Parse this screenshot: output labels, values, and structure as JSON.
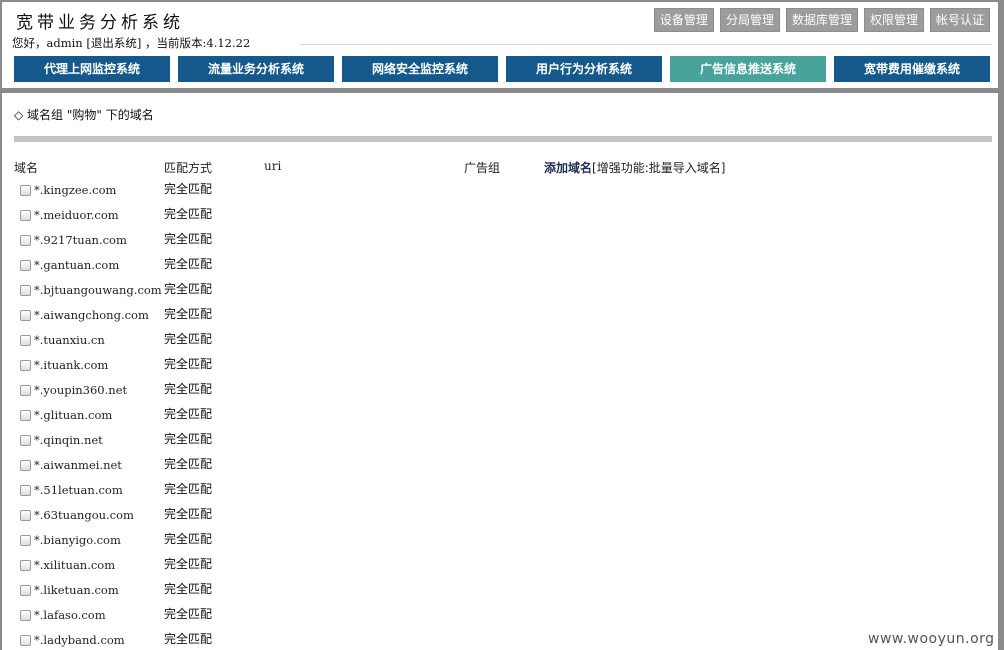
{
  "header": {
    "title": "宽带业务分析系统",
    "greeting": "您好，admin",
    "logout": "[退出系统]",
    "version_text": "，当前版本:4.12.22",
    "top_buttons": [
      "设备管理",
      "分局管理",
      "数据库管理",
      "权限管理",
      "帐号认证"
    ]
  },
  "nav": {
    "tabs": [
      {
        "label": "代理上网监控系统"
      },
      {
        "label": "流量业务分析系统"
      },
      {
        "label": "网络安全监控系统"
      },
      {
        "label": "用户行为分析系统"
      },
      {
        "label": "广告信息推送系统"
      },
      {
        "label": "宽带费用催缴系统"
      }
    ],
    "active_index": 4
  },
  "content": {
    "group_title": "◇ 域名组 \"购物\" 下的域名",
    "columns": {
      "domain": "域名",
      "match": "匹配方式",
      "uri": "uri",
      "ad_group": "广告组",
      "add_domain": "添加域名",
      "batch_import": "[增强功能:批量导入域名]"
    },
    "rows": [
      {
        "domain": "*.kingzee.com",
        "match": "完全匹配"
      },
      {
        "domain": "*.meiduor.com",
        "match": "完全匹配"
      },
      {
        "domain": "*.9217tuan.com",
        "match": "完全匹配"
      },
      {
        "domain": "*.gantuan.com",
        "match": "完全匹配"
      },
      {
        "domain": "*.bjtuangouwang.com",
        "match": "完全匹配"
      },
      {
        "domain": "*.aiwangchong.com",
        "match": "完全匹配"
      },
      {
        "domain": "*.tuanxiu.cn",
        "match": "完全匹配"
      },
      {
        "domain": "*.ituank.com",
        "match": "完全匹配"
      },
      {
        "domain": "*.youpin360.net",
        "match": "完全匹配"
      },
      {
        "domain": "*.glituan.com",
        "match": "完全匹配"
      },
      {
        "domain": "*.qinqin.net",
        "match": "完全匹配"
      },
      {
        "domain": "*.aiwanmei.net",
        "match": "完全匹配"
      },
      {
        "domain": "*.51letuan.com",
        "match": "完全匹配"
      },
      {
        "domain": "*.63tuangou.com",
        "match": "完全匹配"
      },
      {
        "domain": "*.bianyigo.com",
        "match": "完全匹配"
      },
      {
        "domain": "*.xilituan.com",
        "match": "完全匹配"
      },
      {
        "domain": "*.liketuan.com",
        "match": "完全匹配"
      },
      {
        "domain": "*.lafaso.com",
        "match": "完全匹配"
      },
      {
        "domain": "*.ladyband.com",
        "match": "完全匹配"
      }
    ]
  },
  "watermark": "www.wooyun.org",
  "colors": {
    "nav_tab": "#15598c",
    "nav_tab_active": "#48a39c",
    "top_button": "#9c9c9c",
    "frame": "#8a8a8a"
  }
}
